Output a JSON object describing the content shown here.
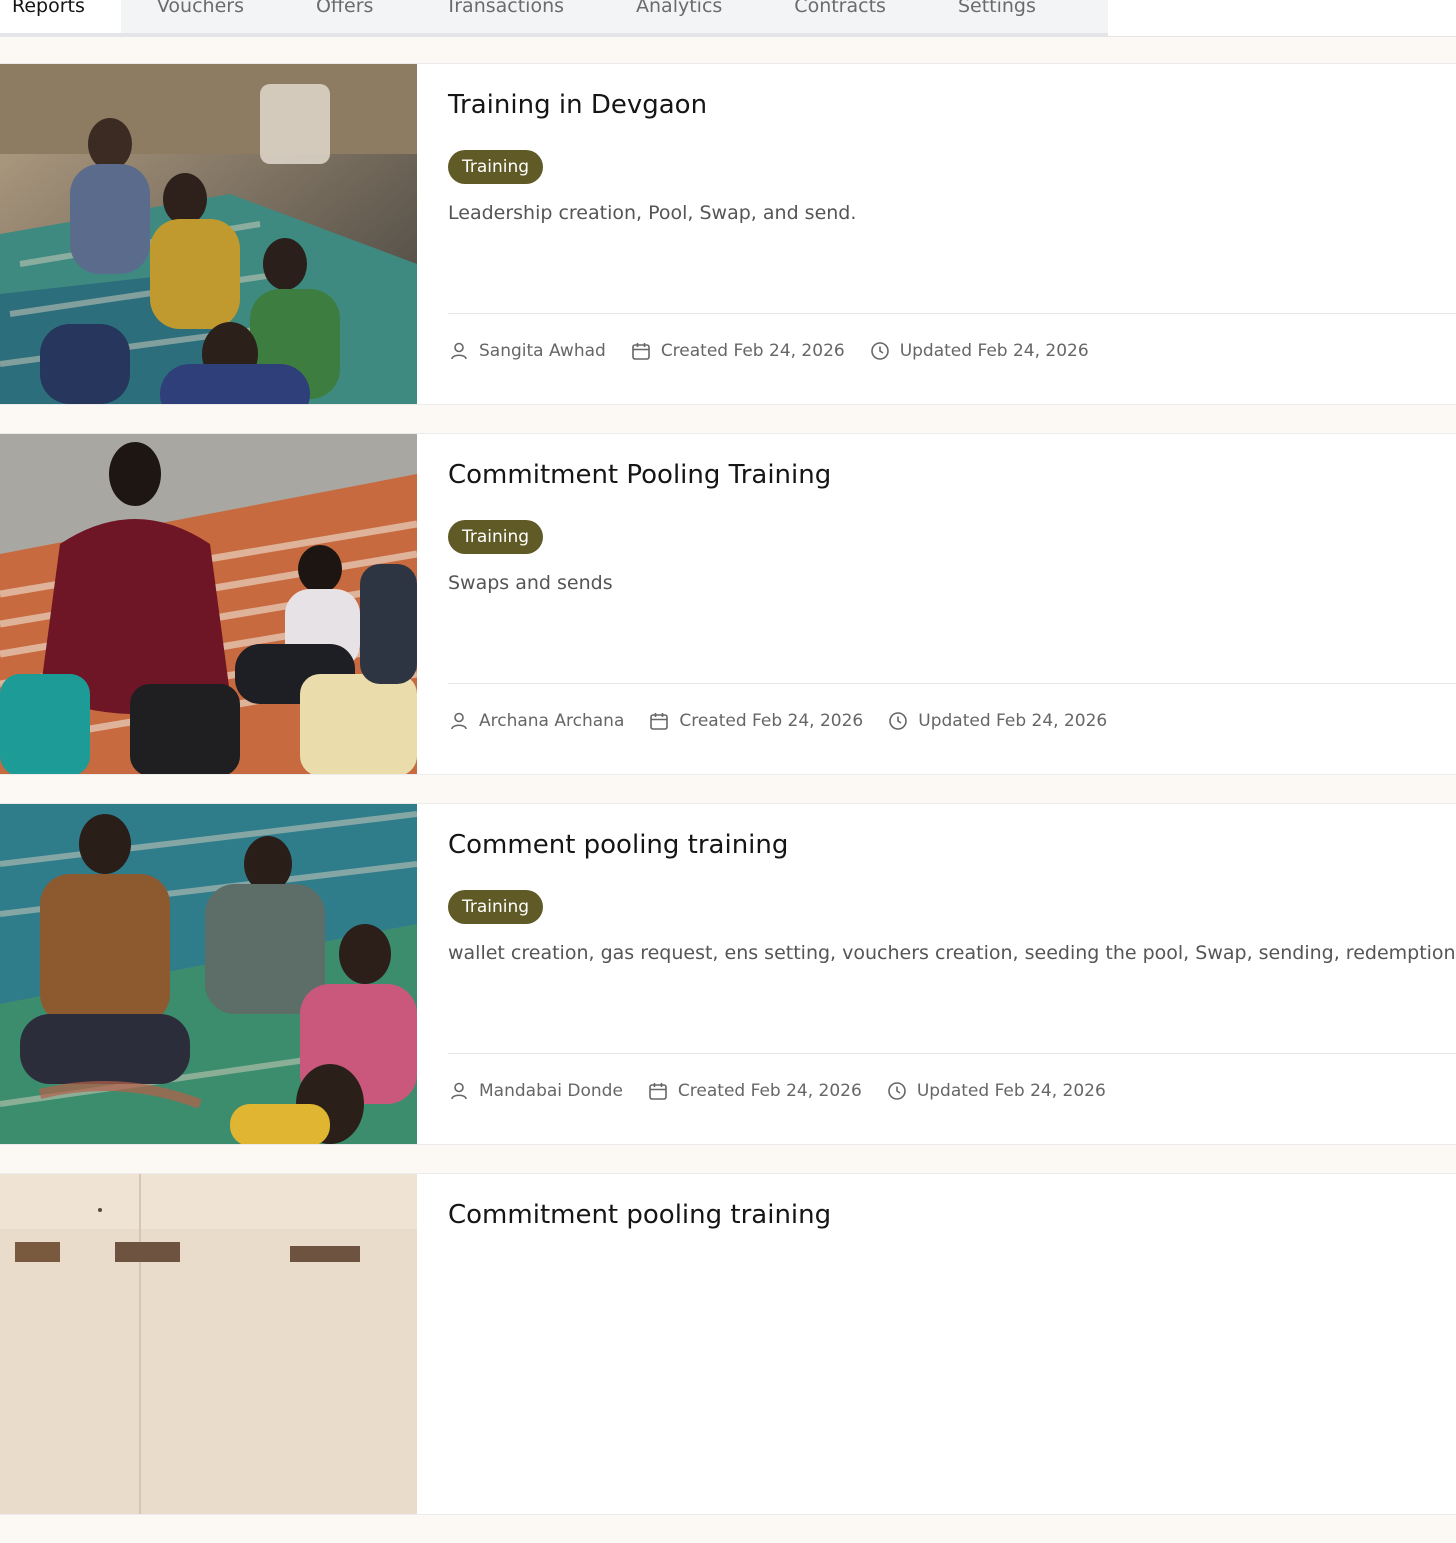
{
  "nav": {
    "tabs": [
      {
        "label": "Reports",
        "active": true
      },
      {
        "label": "Vouchers"
      },
      {
        "label": "Offers"
      },
      {
        "label": "Transactions"
      },
      {
        "label": "Analytics"
      },
      {
        "label": "Contracts"
      },
      {
        "label": "Settings"
      }
    ]
  },
  "theme": {
    "tag_color": "#5f5a26",
    "page_background": "#fcf9f5"
  },
  "reports": [
    {
      "title": "Training in Devgaon",
      "tag": "Training",
      "description": "Leadership creation, Pool, Swap, and send.",
      "author": "Sangita Awhad",
      "created": "Created Feb 24, 2026",
      "updated": "Updated Feb 24, 2026",
      "image_icon": "group-training-photo"
    },
    {
      "title": "Commitment Pooling Training",
      "tag": "Training",
      "description": "Swaps and sends",
      "author": "Archana Archana",
      "created": "Created Feb 24, 2026",
      "updated": "Updated Feb 24, 2026",
      "image_icon": "group-training-photo"
    },
    {
      "title": "Comment pooling training",
      "tag": "Training",
      "description": "wallet creation, gas request, ens setting, vouchers creation, seeding the pool, Swap, sending, redemption",
      "author": "Mandabai Donde",
      "created": "Created Feb 24, 2026",
      "updated": "Updated Feb 24, 2026",
      "image_icon": "group-training-photo"
    },
    {
      "title": "Commitment pooling training",
      "image_icon": "room-photo"
    }
  ]
}
